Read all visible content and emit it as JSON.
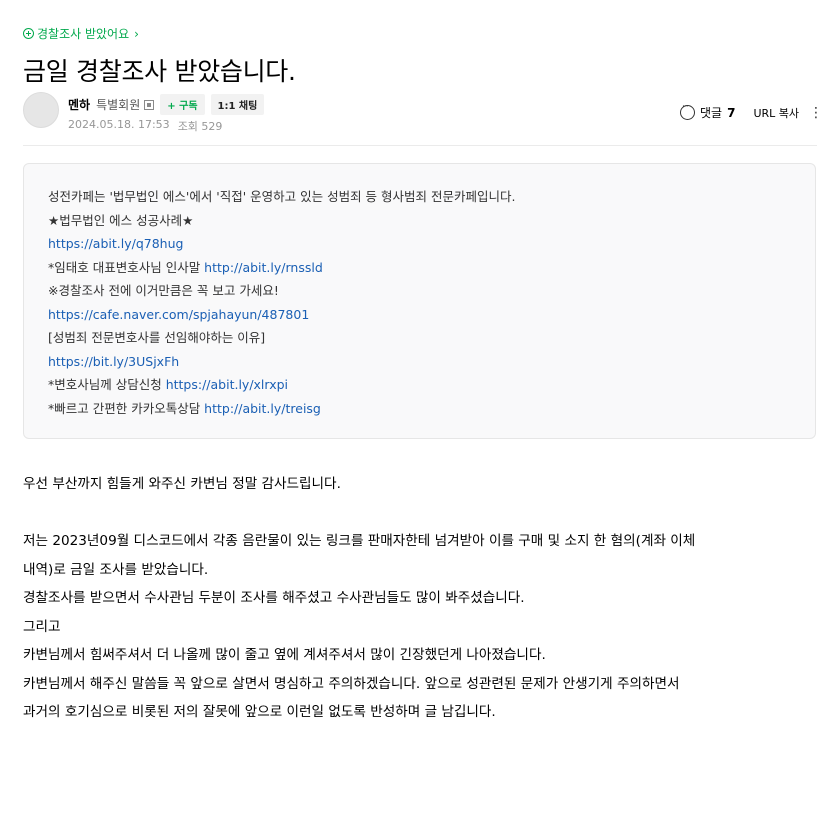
{
  "board_link": "경찰조사 받았어요",
  "title": "금일 경찰조사 받았습니다.",
  "author": {
    "nickname": "멘하",
    "grade": "특별회원",
    "subscribe_label": "+ 구독",
    "chat_label": "1:1 채팅",
    "date": "2024.05.18. 17:53",
    "views_label": "조회 529"
  },
  "tools": {
    "comment_label": "댓글",
    "comment_count": "7",
    "url_copy_label": "URL 복사",
    "more_glyph": "⋮"
  },
  "notice": {
    "line1": "성전카페는 '법무법인 에스'에서 '직접' 운영하고 있는 성범죄 등 형사범죄 전문카페입니다.",
    "line2": "★법무법인 에스 성공사례★",
    "line3_link": "https://abit.ly/q78hug",
    "line4_text": "*임태호 대표변호사님 인사말 ",
    "line4_link": "http://abit.ly/rnssld",
    "line5": "※경찰조사 전에 이거만큼은 꼭 보고 가세요!",
    "line6_link": "https://cafe.naver.com/spjahayun/487801",
    "line7": "[성범죄 전문변호사를 선임해야하는 이유]",
    "line8_link": "https://bit.ly/3USjxFh",
    "line9_text": "*변호사님께 상담신청 ",
    "line9_link": "https://abit.ly/xlrxpi",
    "line10_text": "*빠르고 간편한 카카오톡상담 ",
    "line10_link": "http://abit.ly/treisg"
  },
  "body": {
    "p1": "우선 부산까지 힘들게 와주신 카변님 정말 감사드립니다.",
    "p2a": "저는 2023년09월 디스코드에서 각종 음란물이 있는 링크를 판매자한테 넘겨받아 이를 구매 및 소지 한 혐의(계좌 이체",
    "p2b": "내역)로 금일 조사를 받았습니다.",
    "p3": "경찰조사를 받으면서 수사관님 두분이 조사를 해주셨고 수사관님들도 많이 봐주셨습니다.",
    "p4": "그리고",
    "p5": "카변님께서 힘써주셔서 더 나올께 많이 줄고 옆에 계셔주셔서 많이 긴장했던게 나아졌습니다.",
    "p6a": "카변님께서 해주신 말씀들 꼭 앞으로 살면서 명심하고 주의하겠습니다. 앞으로 성관련된 문제가 안생기게 주의하면서",
    "p6b": "과거의 호기심으로 비롯된 저의 잘못에 앞으로 이런일 없도록 반성하며 글 남깁니다."
  }
}
